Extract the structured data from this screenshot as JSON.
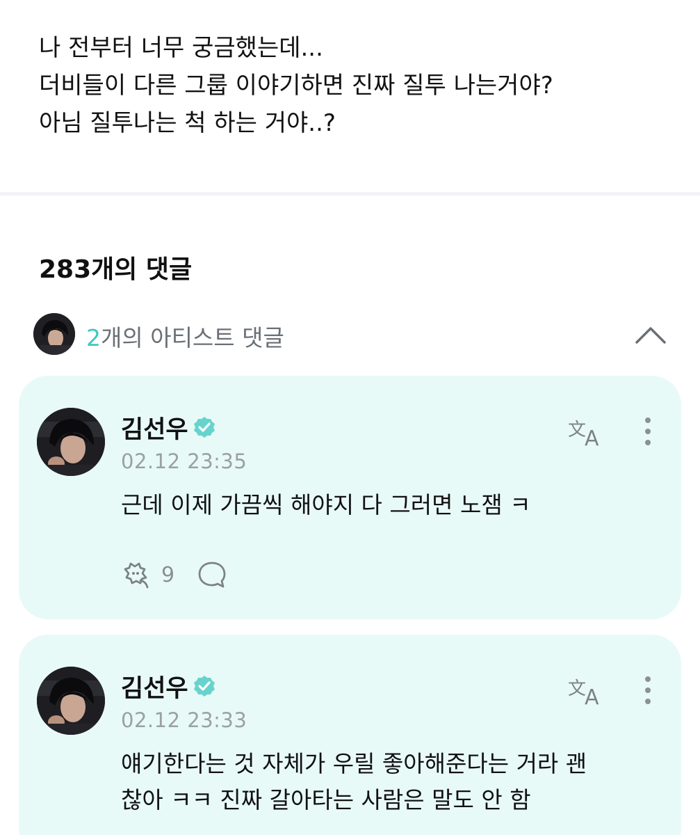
{
  "post": {
    "lines": [
      "나 전부터 너무 궁금했는데...",
      "더비들이 다른 그룹 이야기하면 진짜 질투 나는거야?",
      "아님 질투나는 척 하는 거야..?"
    ]
  },
  "comments_header": {
    "count_label": "283개의 댓글"
  },
  "artist_comments": {
    "count": "2",
    "label": "개의 아티스트 댓글"
  },
  "colors": {
    "accent": "#3dc8bf",
    "card_bg": "#e8faf8",
    "muted": "#9aa0a6"
  },
  "comments": [
    {
      "author": "김선우",
      "date": "02.12 23:35",
      "lines": [
        "근데 이제 가끔씩 해야지 다 그러면 노잼 ㅋ"
      ],
      "likes": "9"
    },
    {
      "author": "김선우",
      "date": "02.12 23:33",
      "lines": [
        "얘기한다는 것 자체가 우릴 좋아해준다는 거라 괜",
        "찮아 ㅋㅋ 진짜 갈아타는 사람은 말도 안 함"
      ]
    }
  ]
}
